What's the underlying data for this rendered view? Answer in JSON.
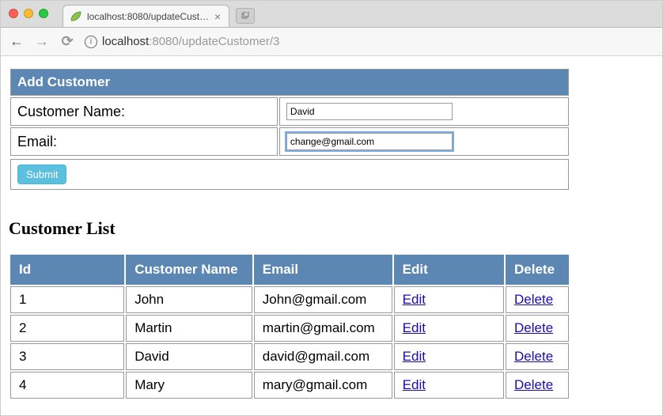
{
  "browser": {
    "tab_title": "localhost:8080/updateCustom",
    "url_host": "localhost",
    "url_port": ":8080",
    "url_path": "/updateCustomer/3"
  },
  "form": {
    "header": "Add Customer",
    "name_label": "Customer Name:",
    "email_label": "Email:",
    "name_value": "David",
    "email_value": "change@gmail.com",
    "submit_label": "Submit"
  },
  "list": {
    "title": "Customer List",
    "headers": {
      "id": "Id",
      "name": "Customer Name",
      "email": "Email",
      "edit": "Edit",
      "delete": "Delete"
    },
    "edit_link_label": "Edit",
    "delete_link_label": "Delete",
    "rows": [
      {
        "id": "1",
        "name": "John",
        "email": "John@gmail.com"
      },
      {
        "id": "2",
        "name": "Martin",
        "email": "martin@gmail.com"
      },
      {
        "id": "3",
        "name": "David",
        "email": "david@gmail.com"
      },
      {
        "id": "4",
        "name": "Mary",
        "email": "mary@gmail.com"
      }
    ]
  }
}
